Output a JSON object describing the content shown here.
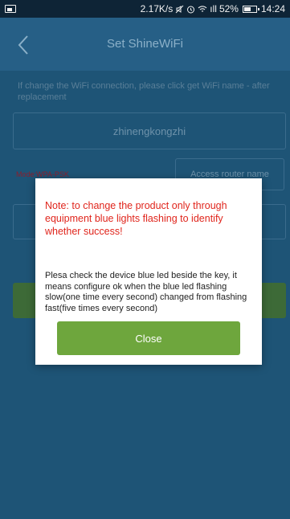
{
  "status_bar": {
    "speed": "2.17K/s",
    "signal": "ıll",
    "battery_percent": "52%",
    "time": "14:24"
  },
  "header": {
    "title": "Set ShineWiFi"
  },
  "form": {
    "hint": "If change the WiFi connection, please click get WiFi name - after replacement",
    "wifi_name": "zhinengkongzhi",
    "mode": "Mode:WPA-PSK",
    "router_button_label": "Access router name"
  },
  "dialog": {
    "note": "Note: to change the product only through equipment blue lights flashing to identify whether success!",
    "message": "Plesa check the device blue led beside the key, it means configure ok when the blue led flashing slow(one time every second) changed from flashing fast(five times every second)",
    "close_label": "Close"
  }
}
